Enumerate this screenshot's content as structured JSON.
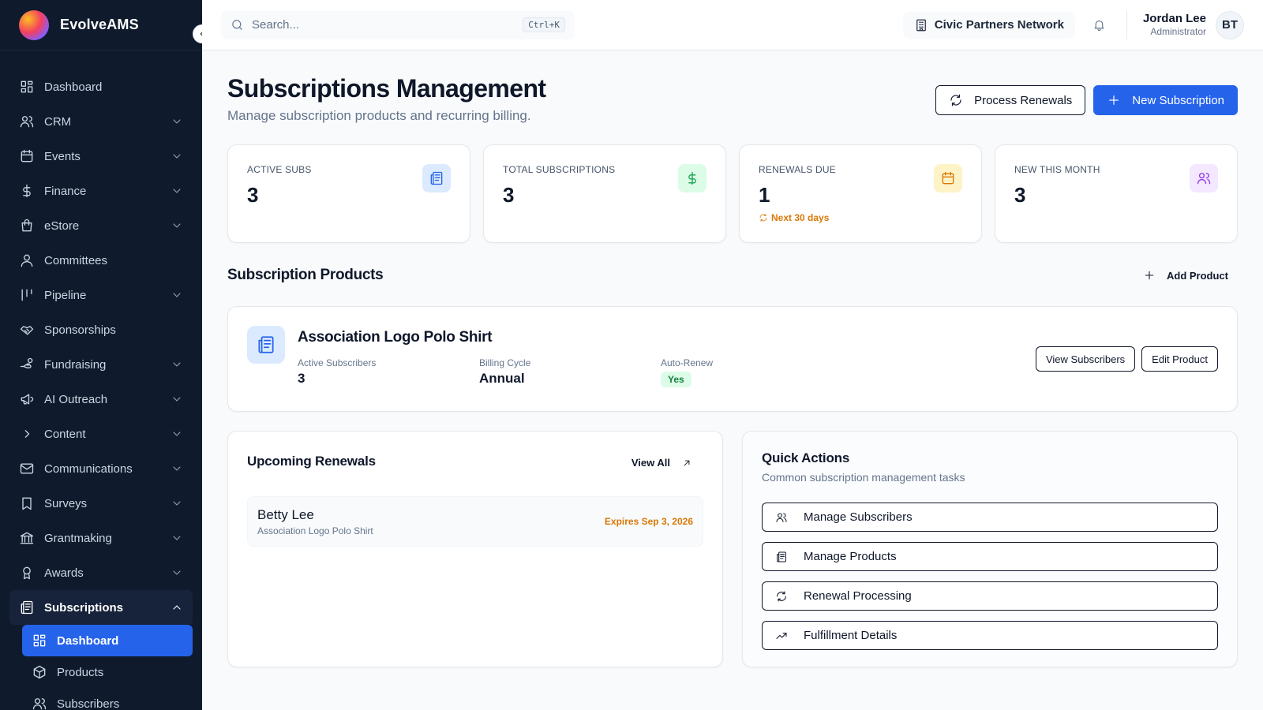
{
  "app": {
    "name": "EvolveAMS"
  },
  "sidebar": {
    "items": [
      {
        "label": "Dashboard",
        "icon": "grid-icon",
        "expandable": false
      },
      {
        "label": "CRM",
        "icon": "users-icon",
        "expandable": true
      },
      {
        "label": "Events",
        "icon": "calendar-icon",
        "expandable": true
      },
      {
        "label": "Finance",
        "icon": "dollar-icon",
        "expandable": true
      },
      {
        "label": "eStore",
        "icon": "bag-icon",
        "expandable": true
      },
      {
        "label": "Committees",
        "icon": "user-group-icon",
        "expandable": false
      },
      {
        "label": "Pipeline",
        "icon": "pipeline-icon",
        "expandable": true
      },
      {
        "label": "Sponsorships",
        "icon": "handshake-icon",
        "expandable": false
      },
      {
        "label": "Fundraising",
        "icon": "hand-coins-icon",
        "expandable": true
      },
      {
        "label": "AI Outreach",
        "icon": "megaphone-icon",
        "expandable": true
      },
      {
        "label": "Content",
        "icon": "chevron-right-icon",
        "expandable": true
      },
      {
        "label": "Communications",
        "icon": "mail-icon",
        "expandable": true
      },
      {
        "label": "Surveys",
        "icon": "bookmark-icon",
        "expandable": true
      },
      {
        "label": "Grantmaking",
        "icon": "bank-icon",
        "expandable": true
      },
      {
        "label": "Awards",
        "icon": "award-icon",
        "expandable": true
      }
    ],
    "subscriptions": {
      "label": "Subscriptions",
      "children": [
        {
          "label": "Dashboard",
          "icon": "grid-icon",
          "active": true
        },
        {
          "label": "Products",
          "icon": "box-icon",
          "active": false
        },
        {
          "label": "Subscribers",
          "icon": "users-icon",
          "active": false
        }
      ]
    }
  },
  "header": {
    "search_placeholder": "Search...",
    "shortcut": "Ctrl+K",
    "org": "Civic Partners Network",
    "user_name": "Jordan Lee",
    "user_role": "Administrator",
    "avatar_initials": "BT"
  },
  "page": {
    "title": "Subscriptions Management",
    "subtitle": "Manage subscription products and recurring billing.",
    "process_renewals": "Process Renewals",
    "new_subscription": "New Subscription"
  },
  "stats": [
    {
      "label": "ACTIVE SUBS",
      "value": "3",
      "note": "",
      "icon": "newspaper-icon",
      "bg": "#dbeafe",
      "color": "#2563eb"
    },
    {
      "label": "TOTAL SUBSCRIPTIONS",
      "value": "3",
      "note": "",
      "icon": "dollar-icon",
      "bg": "#dcfce7",
      "color": "#16a34a"
    },
    {
      "label": "RENEWALS DUE",
      "value": "1",
      "note": "Next 30 days",
      "icon": "calendar-icon",
      "bg": "#fef3c7",
      "color": "#d97706"
    },
    {
      "label": "NEW THIS MONTH",
      "value": "3",
      "note": "",
      "icon": "users-icon",
      "bg": "#f3e8ff",
      "color": "#9333ea"
    }
  ],
  "products_section": {
    "title": "Subscription Products",
    "add_label": "Add Product",
    "product": {
      "name": "Association Logo Polo Shirt",
      "active_label": "Active Subscribers",
      "active_value": "3",
      "cycle_label": "Billing Cycle",
      "cycle_value": "Annual",
      "renew_label": "Auto-Renew",
      "renew_value": "Yes",
      "view_btn": "View Subscribers",
      "edit_btn": "Edit Product"
    }
  },
  "renewals": {
    "title": "Upcoming Renewals",
    "view_all": "View All",
    "items": [
      {
        "name": "Betty Lee",
        "product": "Association Logo Polo Shirt",
        "expires": "Expires Sep 3, 2026"
      }
    ]
  },
  "quick_actions": {
    "title": "Quick Actions",
    "subtitle": "Common subscription management tasks",
    "items": [
      {
        "label": "Manage Subscribers",
        "icon": "users-icon"
      },
      {
        "label": "Manage Products",
        "icon": "newspaper-icon"
      },
      {
        "label": "Renewal Processing",
        "icon": "refresh-icon"
      },
      {
        "label": "Fulfillment Details",
        "icon": "trending-up-icon"
      }
    ]
  },
  "colors": {
    "sidebar_bg": "#0f1b2d",
    "primary": "#2563eb",
    "warning": "#d97706",
    "success": "#16a34a"
  }
}
